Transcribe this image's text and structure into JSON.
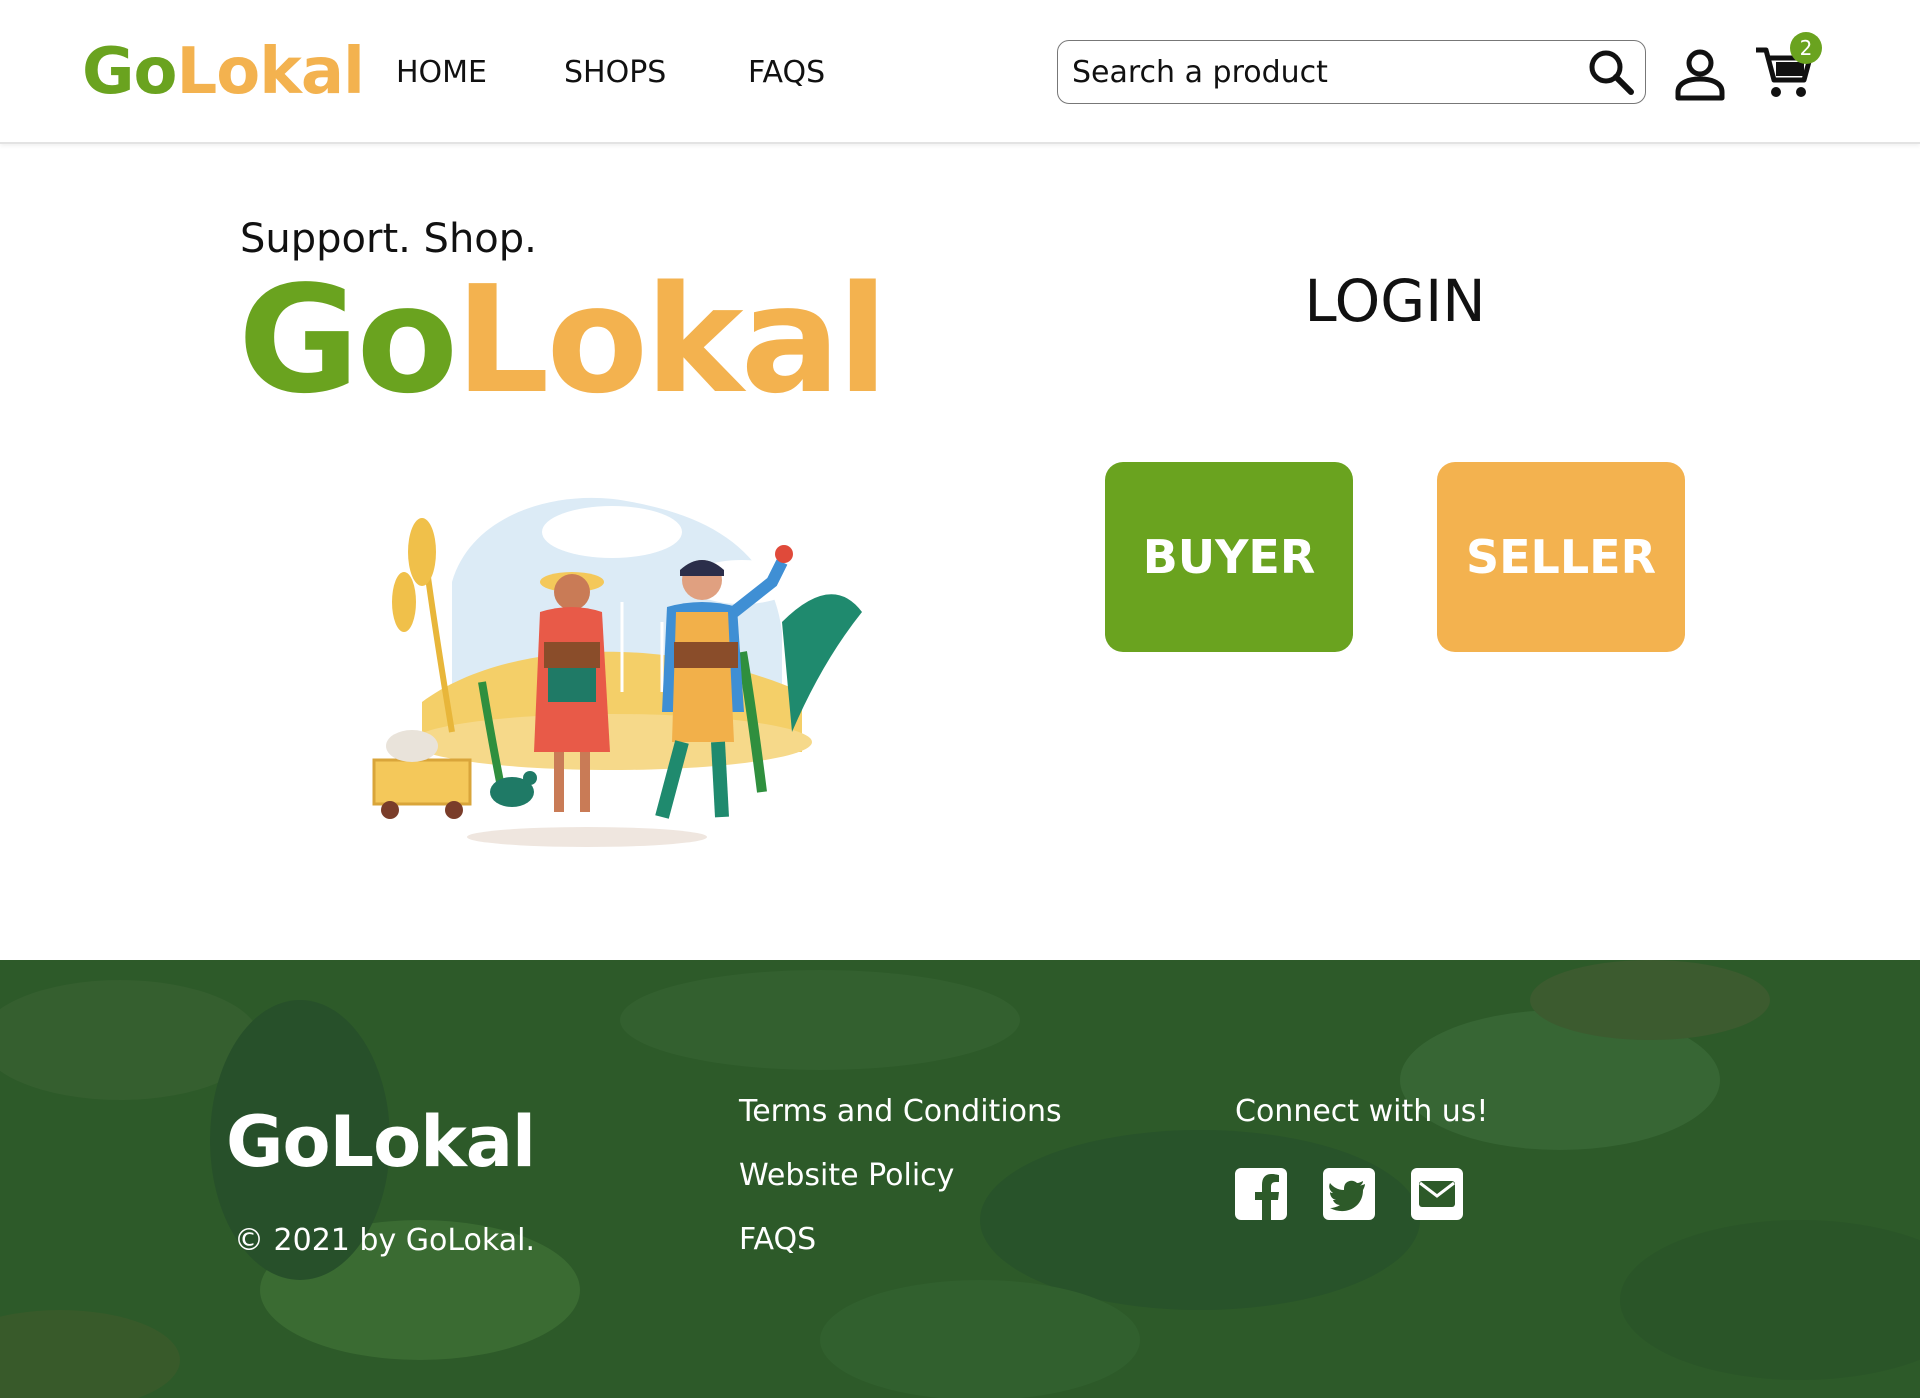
{
  "header": {
    "logo": {
      "part1": "Go",
      "part2": "Lokal"
    },
    "nav": [
      {
        "label": "HOME"
      },
      {
        "label": "SHOPS"
      },
      {
        "label": "FAQS"
      }
    ],
    "search": {
      "placeholder": "Search a product",
      "value": ""
    },
    "cart": {
      "count": "2"
    },
    "icons": {
      "search": "search-icon",
      "user": "user-icon",
      "cart": "cart-icon"
    }
  },
  "hero": {
    "tagline": "Support. Shop.",
    "logo": {
      "part1": "Go",
      "part2": "Lokal"
    }
  },
  "login": {
    "title": "LOGIN",
    "buyer_label": "BUYER",
    "seller_label": "SELLER"
  },
  "footer": {
    "logo": "GoLokal",
    "copyright": "© 2021 by GoLokal.",
    "links": [
      {
        "label": "Terms and Conditions"
      },
      {
        "label": "Website Policy"
      },
      {
        "label": "FAQS"
      }
    ],
    "connect_label": "Connect with us!",
    "social": [
      "facebook-icon",
      "twitter-icon",
      "email-icon"
    ]
  },
  "colors": {
    "brand_green": "#6aa31f",
    "brand_orange": "#f3b24f",
    "footer_green": "#2e5a2a"
  }
}
